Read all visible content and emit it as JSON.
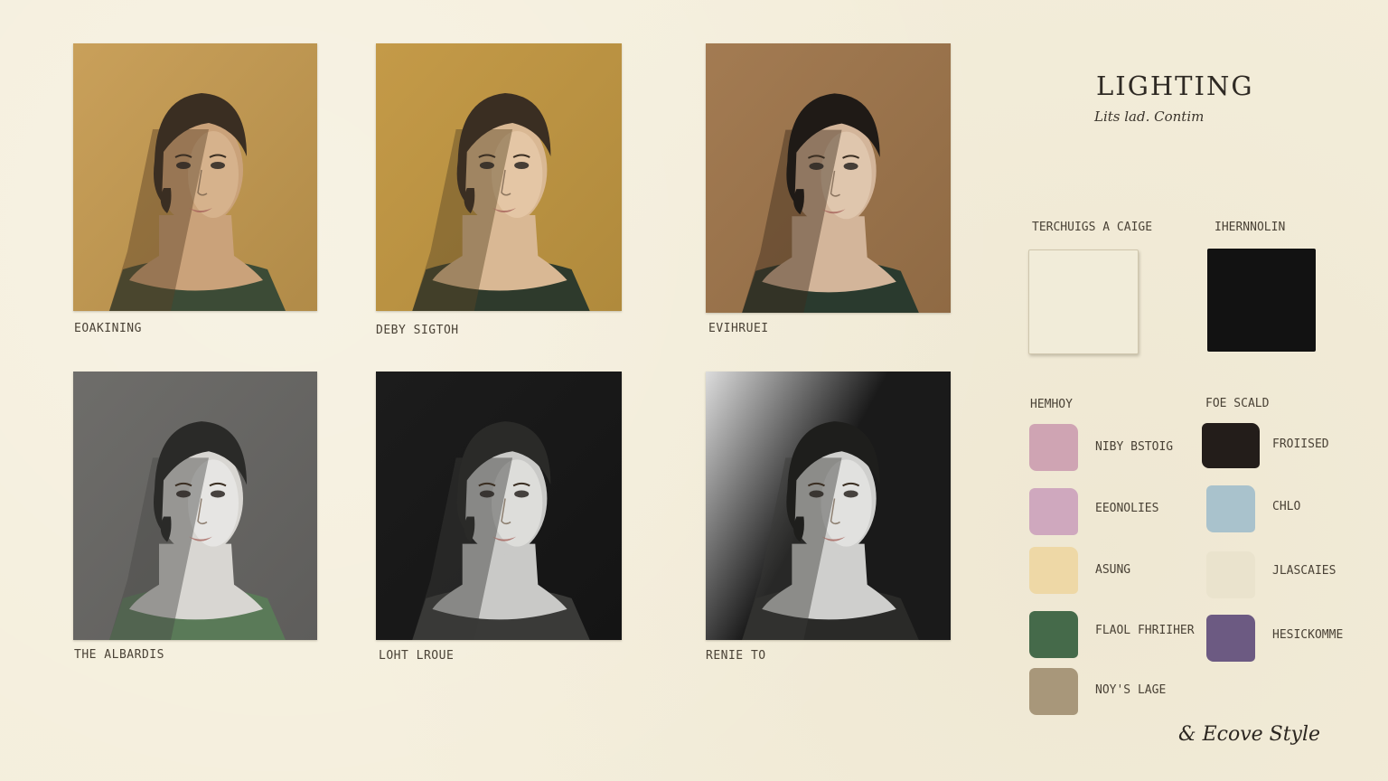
{
  "header": {
    "title": "LIGHTING",
    "subtitle": "Lits lad. Contim"
  },
  "portraits": [
    {
      "caption": "EOAKINING",
      "bg": "#b18b48",
      "bg2": "#c9a05a",
      "skin": "#caa27a",
      "shadow": "#5a4126",
      "hair": "#3a2e22",
      "dress": "#3c4b36",
      "highlight": "#e0c09a"
    },
    {
      "caption": "DEBY SIGTOH",
      "bg": "#b08a3c",
      "bg2": "#c49a48",
      "skin": "#d9b894",
      "shadow": "#5c4626",
      "hair": "#3a2e22",
      "dress": "#2e3a2c",
      "highlight": "#ecd2b2"
    },
    {
      "caption": "EVIHRUEI",
      "bg": "#8f6a44",
      "bg2": "#a37b52",
      "skin": "#d3b59a",
      "shadow": "#3d2c1c",
      "hair": "#1f1a16",
      "dress": "#2a3a2e",
      "highlight": "#ead4bd"
    },
    {
      "caption": "THE ALBARDIS",
      "bg": "#5e5d5b",
      "bg2": "#6e6d6a",
      "skin": "#d8d6d2",
      "shadow": "#4a4946",
      "hair": "#2a2a28",
      "dress": "#5a7a58",
      "highlight": "#f2f2f0"
    },
    {
      "caption": "LOHT LROUE",
      "bg": "#141414",
      "bg2": "#1c1c1c",
      "skin": "#c9c9c7",
      "shadow": "#3a3a38",
      "hair": "#2a2a28",
      "dress": "#3a3a38",
      "highlight": "#ececea"
    },
    {
      "caption": "RENIE TO",
      "bg": "#1a1a1a",
      "bg2": "#dcdcdc",
      "skin": "#cfcfcd",
      "shadow": "#3a3a38",
      "hair": "#1e1e1c",
      "dress": "#2a2a28",
      "highlight": "#f0f0ee"
    }
  ],
  "tones": {
    "light_label": "TERCHUIGS A CAIGE",
    "light_color": "#f1ecd9",
    "dark_label": "IHERNNOLIN",
    "dark_color": "#121212"
  },
  "palette": {
    "left_label": "HEMHOY",
    "right_label": "FOE SCALD",
    "left": [
      {
        "label": "NIBY BSTOIG",
        "color": "#cfa4b3"
      },
      {
        "label": "EEONOLIES",
        "color": "#cfa8be"
      },
      {
        "label": "ASUNG",
        "color": "#eed8a6"
      },
      {
        "label": "FLAOL FHRIIHER",
        "color": "#456a4a"
      },
      {
        "label": "NOY'S LAGE",
        "color": "#a8977a"
      }
    ],
    "right": [
      {
        "label": "FROIISED",
        "color": "#231d1a"
      },
      {
        "label": "CHLO",
        "color": "#a9c2cc"
      },
      {
        "label": "JLASCAIES",
        "color": "#eae3cd"
      },
      {
        "label": "HESICKOMME",
        "color": "#6c5a82"
      }
    ]
  },
  "signature": "& Ecove Style"
}
